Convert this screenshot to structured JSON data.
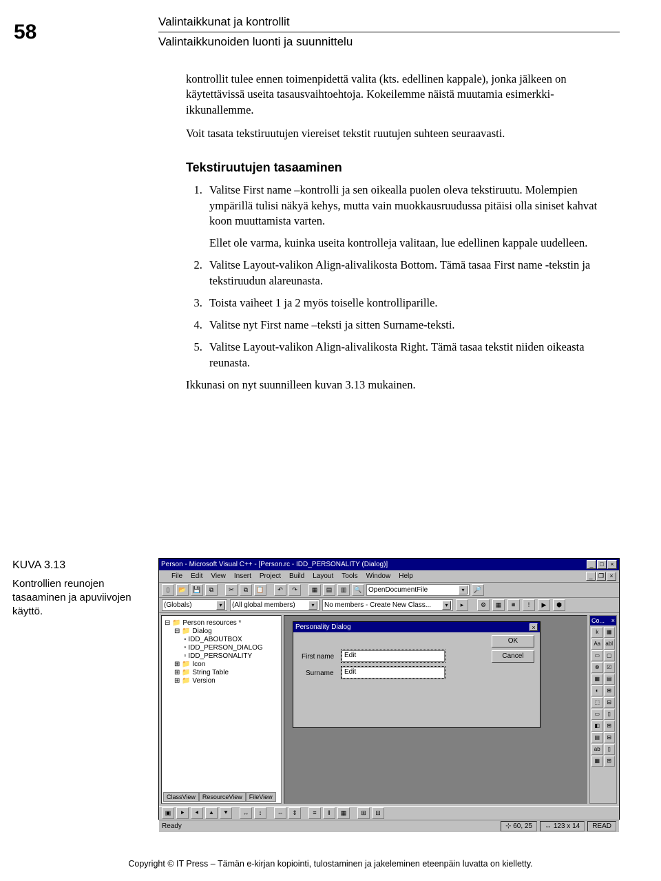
{
  "page_number": "58",
  "chapter_title": "Valintaikkunat ja kontrollit",
  "section_title": "Valintaikkunoiden luonti ja suunnittelu",
  "intro_p1": "kontrollit tulee ennen toimenpidettä valita (kts. edellinen kappale), jonka jälkeen on käytettävissä useita tasausvaihtoehtoja. Kokeilemme näistä muutamia esimerkki-ikkunallemme.",
  "intro_p2": "Voit tasata tekstiruutujen viereiset tekstit ruutujen suhteen seuraavasti.",
  "subhead": "Tekstiruutujen tasaaminen",
  "steps": {
    "s1a": "Valitse First name –kontrolli ja sen oikealla puolen oleva tekstiruutu. Molempien ympärillä tulisi näkyä kehys, mutta vain muokkausruudussa pitäisi olla siniset kahvat koon muuttamista varten.",
    "s1b": "Ellet ole varma, kuinka useita kontrolleja valitaan, lue edellinen kappale uudelleen.",
    "s2": "Valitse Layout-valikon Align-alivalikosta Bottom. Tämä tasaa First name -tekstin ja tekstiruudun alareunasta.",
    "s3": "Toista vaiheet 1 ja 2 myös toiselle kontrolliparille.",
    "s4": "Valitse nyt First name –teksti ja sitten Surname-teksti.",
    "s5": "Valitse Layout-valikon Align-alivalikosta Right. Tämä tasaa tekstit niiden oikeasta reunasta."
  },
  "after_steps": "Ikkunasi on nyt suunnilleen kuvan 3.13 mukainen.",
  "figure": {
    "label": "KUVA 3.13",
    "desc": "Kontrollien reunojen tasaaminen ja apuviivojen käyttö."
  },
  "ide": {
    "title": "Person - Microsoft Visual C++ - [Person.rc - IDD_PERSONALITY (Dialog)]",
    "menus": [
      "File",
      "Edit",
      "View",
      "Insert",
      "Project",
      "Build",
      "Layout",
      "Tools",
      "Window",
      "Help"
    ],
    "combo_open_doc": "OpenDocumentFile",
    "combo_globals": "(Globals)",
    "combo_all_members": "(All global members)",
    "combo_no_members": "No members - Create New Class...",
    "tree": {
      "root": "Person resources *",
      "dialog_folder": "Dialog",
      "items": [
        "IDD_ABOUTBOX",
        "IDD_PERSON_DIALOG",
        "IDD_PERSONALITY"
      ],
      "icon_folder": "Icon",
      "string_table": "String Table",
      "version": "Version",
      "tabs": [
        "ClassView",
        "ResourceView",
        "FileView"
      ]
    },
    "dialog": {
      "title": "Personality Dialog",
      "ok": "OK",
      "cancel": "Cancel",
      "first_name": "First name",
      "surname": "Surname",
      "edit_placeholder": "Edit"
    },
    "toolbox_title": "Co...",
    "toolbox_cells": [
      "k",
      "▦",
      "Aa",
      "abl",
      "▭",
      "▢",
      "⊗",
      "☑",
      "▦",
      "▤",
      "◐",
      "⊞",
      "⬚",
      "⊟",
      "▭",
      "▯",
      "◧",
      "⊞",
      "▤",
      "⊟",
      "ab",
      "▯",
      "▦",
      "⊞"
    ],
    "status": {
      "ready": "Ready",
      "pos": "60, 25",
      "size": "123 x 14",
      "mode": "READ"
    }
  },
  "footer": "Copyright © IT Press – Tämän e-kirjan kopiointi, tulostaminen ja jakeleminen eteenpäin luvatta on kielletty."
}
